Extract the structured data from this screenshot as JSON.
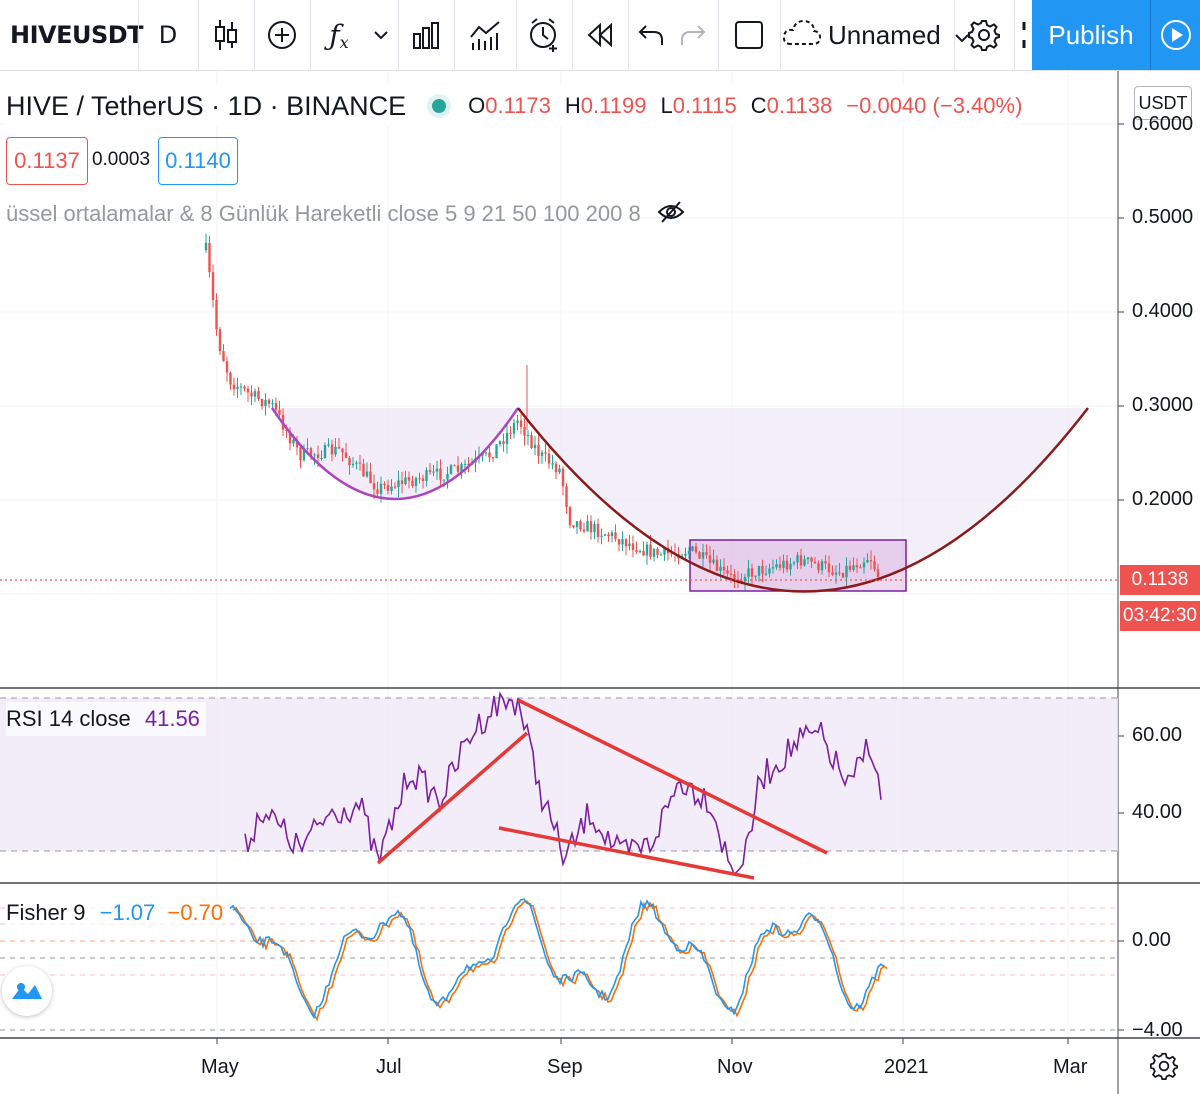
{
  "toolbar": {
    "symbol": "HIVEUSDT",
    "interval": "D",
    "layout_name": "Unnamed",
    "publish_label": "Publish",
    "icons": [
      "candles-icon",
      "add-indicator-icon",
      "fx-icon",
      "chevron-down-icon",
      "bars-compare-icon",
      "templates-icon",
      "alert-icon",
      "replay-icon",
      "undo-icon",
      "redo-icon",
      "fullscreen-icon",
      "cloud-icon",
      "settings-icon",
      "publish-play-icon"
    ]
  },
  "legend": {
    "title": "HIVE / TetherUS · 1D · BINANCE",
    "status_color": "#26a69a",
    "o_label": "O",
    "o": "0.1173",
    "h_label": "H",
    "h": "0.1199",
    "l_label": "L",
    "l": "0.1115",
    "c_label": "C",
    "c": "0.1138",
    "change": "−0.0040 (−3.40%)",
    "bid": "0.1137",
    "spread": "0.0003",
    "ask": "0.1140",
    "study": "üssel ortalamalar & 8 Günlük Hareketli close 5 9 21 50 100 200 8"
  },
  "price_axis": {
    "currency": "USDT",
    "ticks": [
      "0.6000",
      "0.5000",
      "0.4000",
      "0.3000",
      "0.2000"
    ],
    "last_price": "0.1138",
    "countdown": "03:42:30",
    "down_color": "#ef5350",
    "up_color": "#26a69a"
  },
  "rsi": {
    "label": "RSI 14 close",
    "value": "41.56",
    "ticks": [
      "60.00",
      "40.00"
    ],
    "color": "#7b1fa2"
  },
  "fisher": {
    "label": "Fisher 9",
    "value1": "−1.07",
    "value2": "−0.70",
    "ticks": [
      "0.00",
      "−4.00"
    ],
    "color1": "#2196f3",
    "color2": "#ff6d00"
  },
  "time_axis": {
    "labels": [
      "May",
      "Jul",
      "Sep",
      "Nov",
      "2021",
      "Mar"
    ]
  }
}
